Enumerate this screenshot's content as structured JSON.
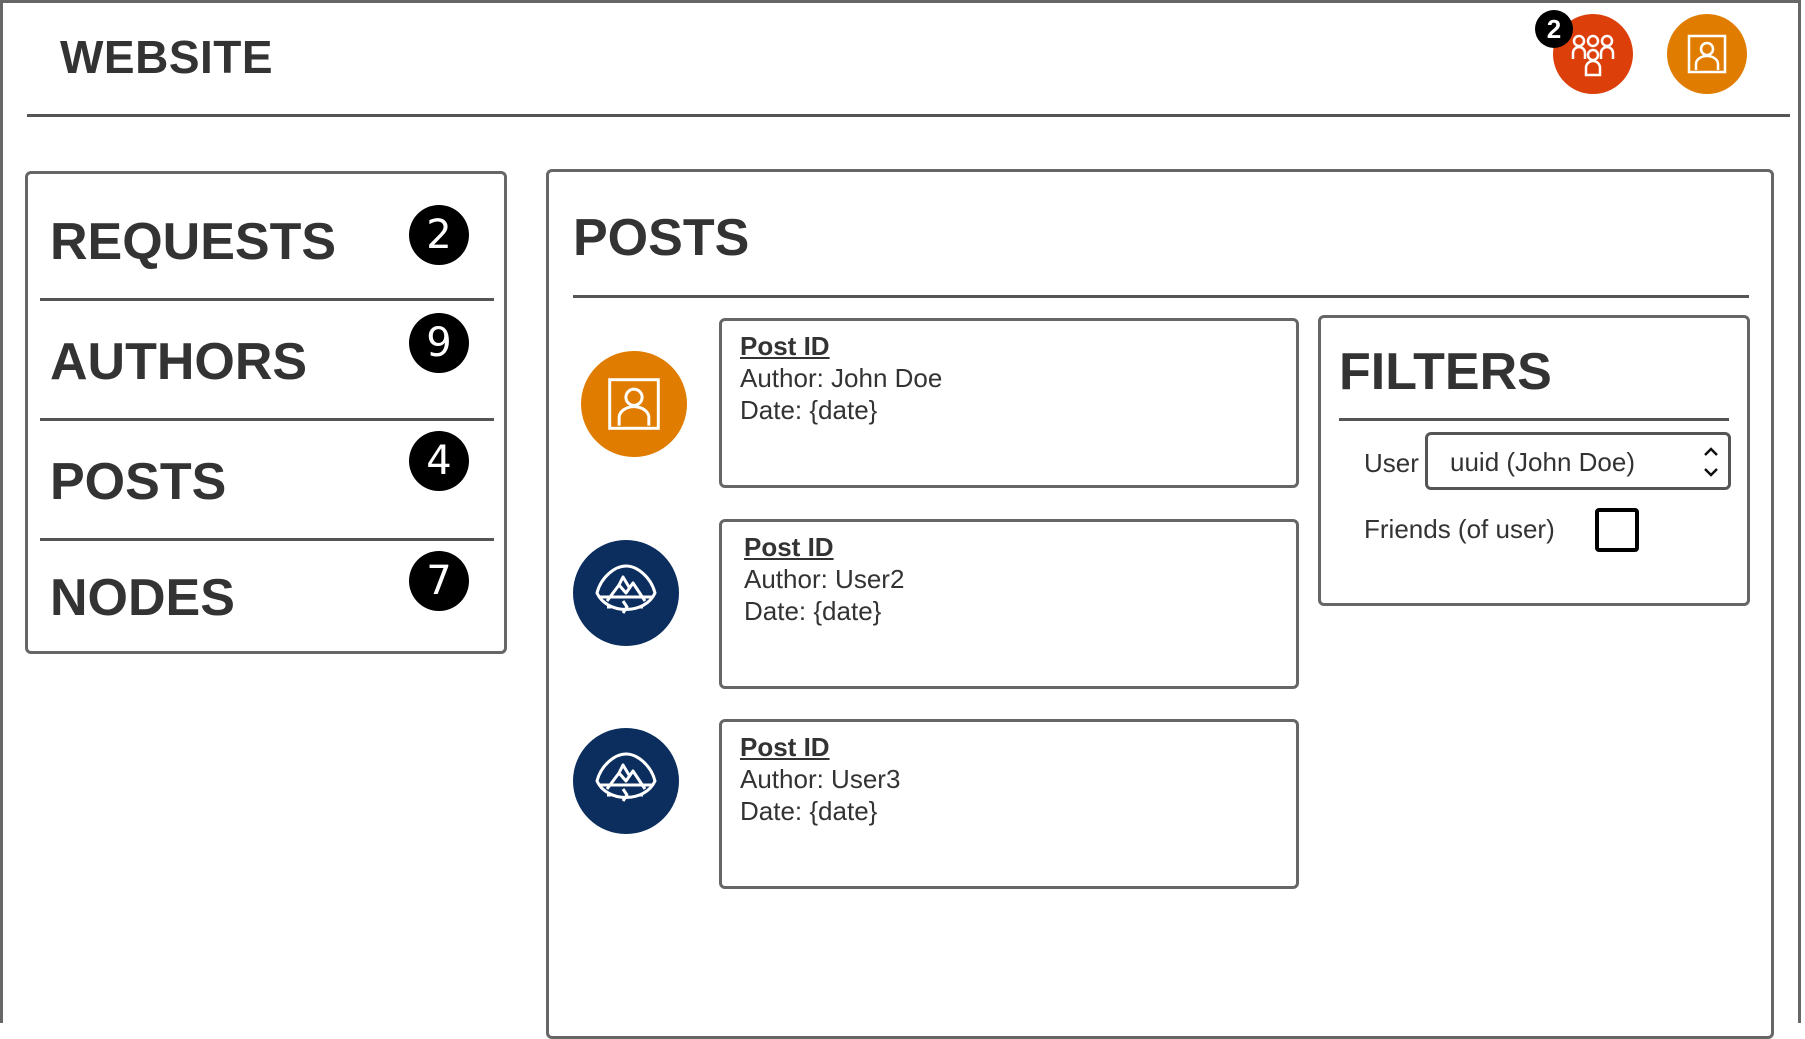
{
  "header": {
    "title": "WEBSITE",
    "friends_badge": "2",
    "friends_icon": "friends-group-icon",
    "profile_icon": "user-profile-icon",
    "friends_color": "#DD3F0B",
    "profile_color": "#E07C00"
  },
  "sidebar": {
    "items": [
      {
        "label": "REQUESTS",
        "count": "2"
      },
      {
        "label": "AUTHORS",
        "count": "9"
      },
      {
        "label": "POSTS",
        "count": "4"
      },
      {
        "label": "NODES",
        "count": "7"
      }
    ]
  },
  "main": {
    "title": "POSTS",
    "posts": [
      {
        "id_label": "Post ID",
        "author": "Author: John Doe",
        "date": "Date: {date}",
        "avatar_icon": "user-profile-icon",
        "avatar_color": "#E07C00"
      },
      {
        "id_label": "Post ID",
        "author": "Author: User2",
        "date": "Date: {date}",
        "avatar_icon": "mountain-shield-icon",
        "avatar_color": "#0B2E5E"
      },
      {
        "id_label": "Post ID",
        "author": "Author: User3",
        "date": "Date: {date}",
        "avatar_icon": "mountain-shield-icon",
        "avatar_color": "#0B2E5E"
      }
    ]
  },
  "filters": {
    "title": "FILTERS",
    "user_label": "User",
    "user_value": "uuid (John Doe)",
    "friends_label": "Friends (of user)",
    "friends_checked": false
  }
}
